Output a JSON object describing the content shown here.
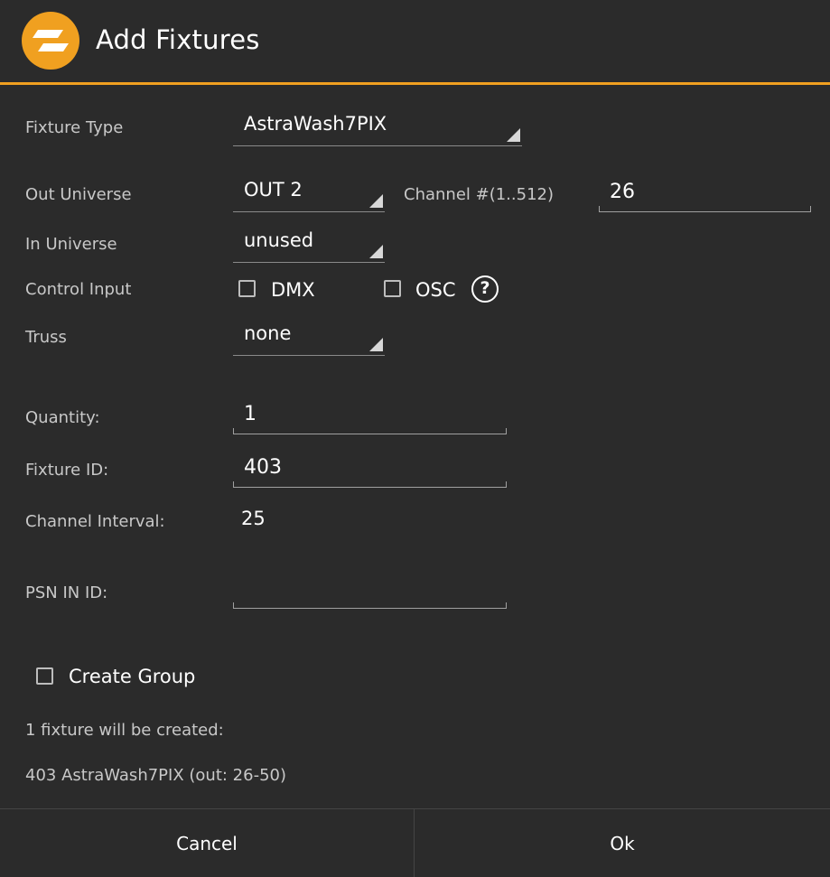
{
  "header": {
    "title": "Add Fixtures",
    "logo_icon": "lightning-bolt-icon",
    "accent_color": "#f0a020"
  },
  "form": {
    "fixture_type": {
      "label": "Fixture Type",
      "value": "AstraWash7PIX"
    },
    "out_universe": {
      "label": "Out Universe",
      "value": "OUT 2"
    },
    "channel": {
      "label": "Channel #(1..512)",
      "value": "26"
    },
    "in_universe": {
      "label": "In Universe",
      "value": "unused"
    },
    "control_input": {
      "label": "Control Input",
      "dmx": {
        "label": "DMX",
        "checked": false
      },
      "osc": {
        "label": "OSC",
        "checked": false
      },
      "help_icon": "help-icon",
      "help_glyph": "?"
    },
    "truss": {
      "label": "Truss",
      "value": "none"
    },
    "quantity": {
      "label": "Quantity:",
      "value": "1"
    },
    "fixture_id": {
      "label": "Fixture ID:",
      "value": "403"
    },
    "channel_interval": {
      "label": "Channel Interval:",
      "value": "25"
    },
    "psn_in_id": {
      "label": "PSN IN ID:",
      "value": ""
    },
    "create_group": {
      "label": "Create Group",
      "checked": false
    }
  },
  "summary": {
    "count_text": "1 fixture will be created:",
    "detail_text": "403 AstraWash7PIX (out: 26-50)"
  },
  "footer": {
    "cancel_label": "Cancel",
    "ok_label": "Ok"
  }
}
